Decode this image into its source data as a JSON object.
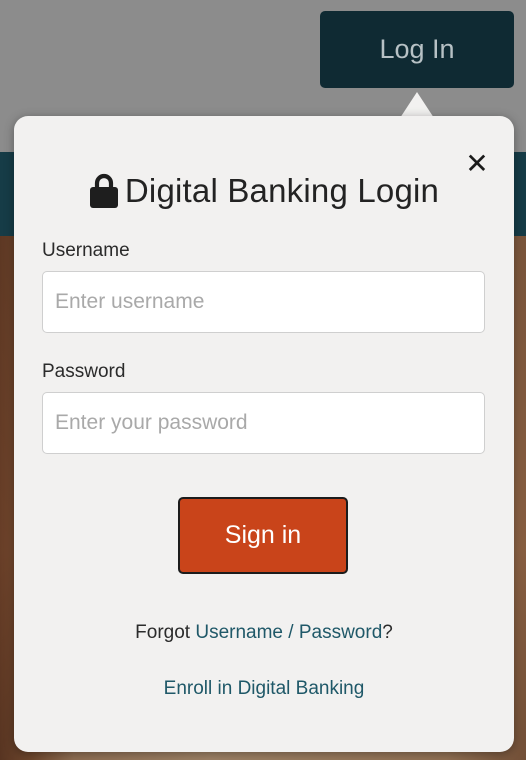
{
  "header": {
    "login_button_label": "Log In"
  },
  "popup": {
    "title": "Digital Banking Login",
    "close_glyph": "✕",
    "username": {
      "label": "Username",
      "placeholder": "Enter username",
      "value": ""
    },
    "password": {
      "label": "Password",
      "placeholder": "Enter your password",
      "value": ""
    },
    "signin_label": "Sign in",
    "forgot": {
      "prefix": "Forgot ",
      "username_link": "Username",
      "separator": " / ",
      "password_link": "Password",
      "suffix": "?"
    },
    "enroll_link": "Enroll in Digital Banking"
  },
  "colors": {
    "accent_orange": "#c9441a",
    "navy": "#0f2a33",
    "link_teal": "#1f5868",
    "popup_bg": "#f2f1f0"
  },
  "icons": {
    "title_icon": "lock-icon",
    "close_icon": "close-icon"
  }
}
